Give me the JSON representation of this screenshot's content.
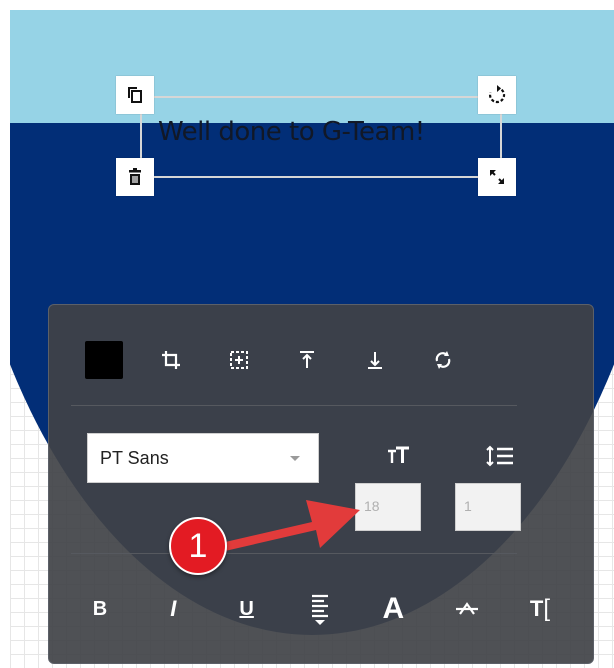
{
  "canvas": {
    "text_element": "Well done to G-Team!"
  },
  "handles": {
    "top_left": "copy-icon",
    "top_right": "rotate-icon",
    "bottom_left": "trash-icon",
    "bottom_right": "resize-icon"
  },
  "toolbar": {
    "color_swatch": "#000000",
    "icons": [
      "crop-icon",
      "align-center-icon",
      "bring-to-front-icon",
      "send-to-back-icon",
      "flip-icon"
    ],
    "font_family": "PT Sans",
    "font_size": "18",
    "line_height": "1",
    "format_icons": [
      "bold-icon",
      "italic-icon",
      "underline-icon",
      "align-icon",
      "text-color-icon",
      "strikethrough-icon",
      "text-cursor-icon"
    ],
    "format_labels": {
      "bold": "B",
      "italic": "I",
      "underline": "U",
      "color": "A",
      "text_tool": "T"
    }
  },
  "annotation": {
    "step_number": "1",
    "badge_color": "#e31b23"
  },
  "colors": {
    "light_blue": "#96d3e6",
    "navy": "#022e77",
    "panel": "#404246"
  }
}
